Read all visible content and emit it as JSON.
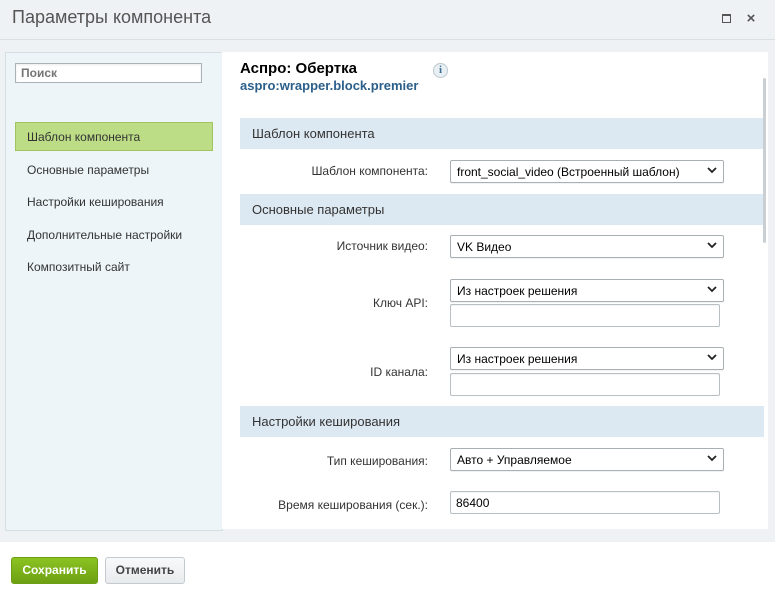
{
  "window": {
    "title": "Параметры компонента",
    "maximize_icon": "maximize-icon",
    "close_icon": "close-icon",
    "close_glyph": "×"
  },
  "sidebar": {
    "search_placeholder": "Поиск",
    "items": [
      {
        "label": "Шаблон компонента",
        "active": true
      },
      {
        "label": "Основные параметры",
        "active": false
      },
      {
        "label": "Настройки кеширования",
        "active": false
      },
      {
        "label": "Дополнительные настройки",
        "active": false
      },
      {
        "label": "Композитный сайт",
        "active": false
      }
    ]
  },
  "component": {
    "name": "Аспро: Обертка",
    "code": "aspro:wrapper.block.premier",
    "info_icon": "info-icon",
    "info_glyph": "i"
  },
  "sections": {
    "template": {
      "title": "Шаблон компонента",
      "template_label": "Шаблон компонента:",
      "template_value": "front_social_video (Встроенный шаблон)"
    },
    "main": {
      "title": "Основные параметры",
      "source_label": "Источник видео:",
      "source_value": "VK Видео",
      "api_key_label": "Ключ API:",
      "api_key_value": "Из настроек решения",
      "api_key_input": "",
      "channel_label": "ID канала:",
      "channel_value": "Из настроек решения",
      "channel_input": ""
    },
    "cache": {
      "title": "Настройки кеширования",
      "type_label": "Тип кеширования:",
      "type_value": "Авто + Управляемое",
      "time_label": "Время кеширования (сек.):",
      "time_value": "86400"
    }
  },
  "footer": {
    "save_label": "Сохранить",
    "cancel_label": "Отменить"
  },
  "colors": {
    "active_nav": "#bcdd86",
    "section_header": "#dde9f2",
    "save_button": "#7fb41d",
    "link_blue": "#2b5f8a"
  }
}
